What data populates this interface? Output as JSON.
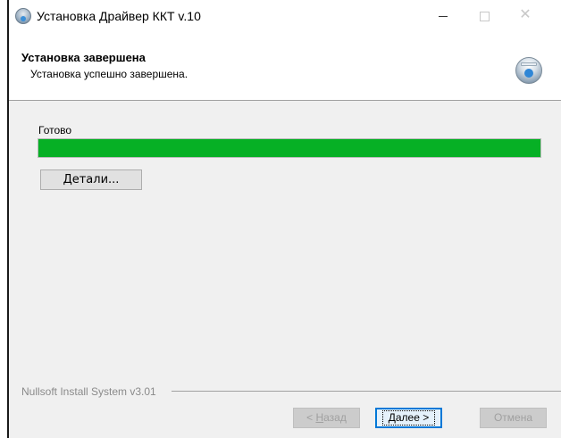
{
  "window": {
    "title": "Установка Драйвер ККТ v.10",
    "icon": "installer-disc-icon",
    "controls": {
      "minimize": "—",
      "maximize": "□",
      "close": "✕"
    }
  },
  "header": {
    "title": "Установка завершена",
    "subtitle": "Установка успешно завершена.",
    "icon": "installer-disc-icon"
  },
  "main": {
    "status_label": "Готово",
    "progress_percent": 100,
    "progress_color": "#06b025",
    "details_button": {
      "underlined_char": "Д",
      "rest": "етали..."
    }
  },
  "footer": {
    "branding": "Nullsoft Install System v3.01",
    "back_button": {
      "prefix": "< ",
      "underlined_char": "Н",
      "rest": "азад"
    },
    "next_button": {
      "underlined_char": "Д",
      "rest": "алее >"
    },
    "cancel_button": "Отмена"
  }
}
